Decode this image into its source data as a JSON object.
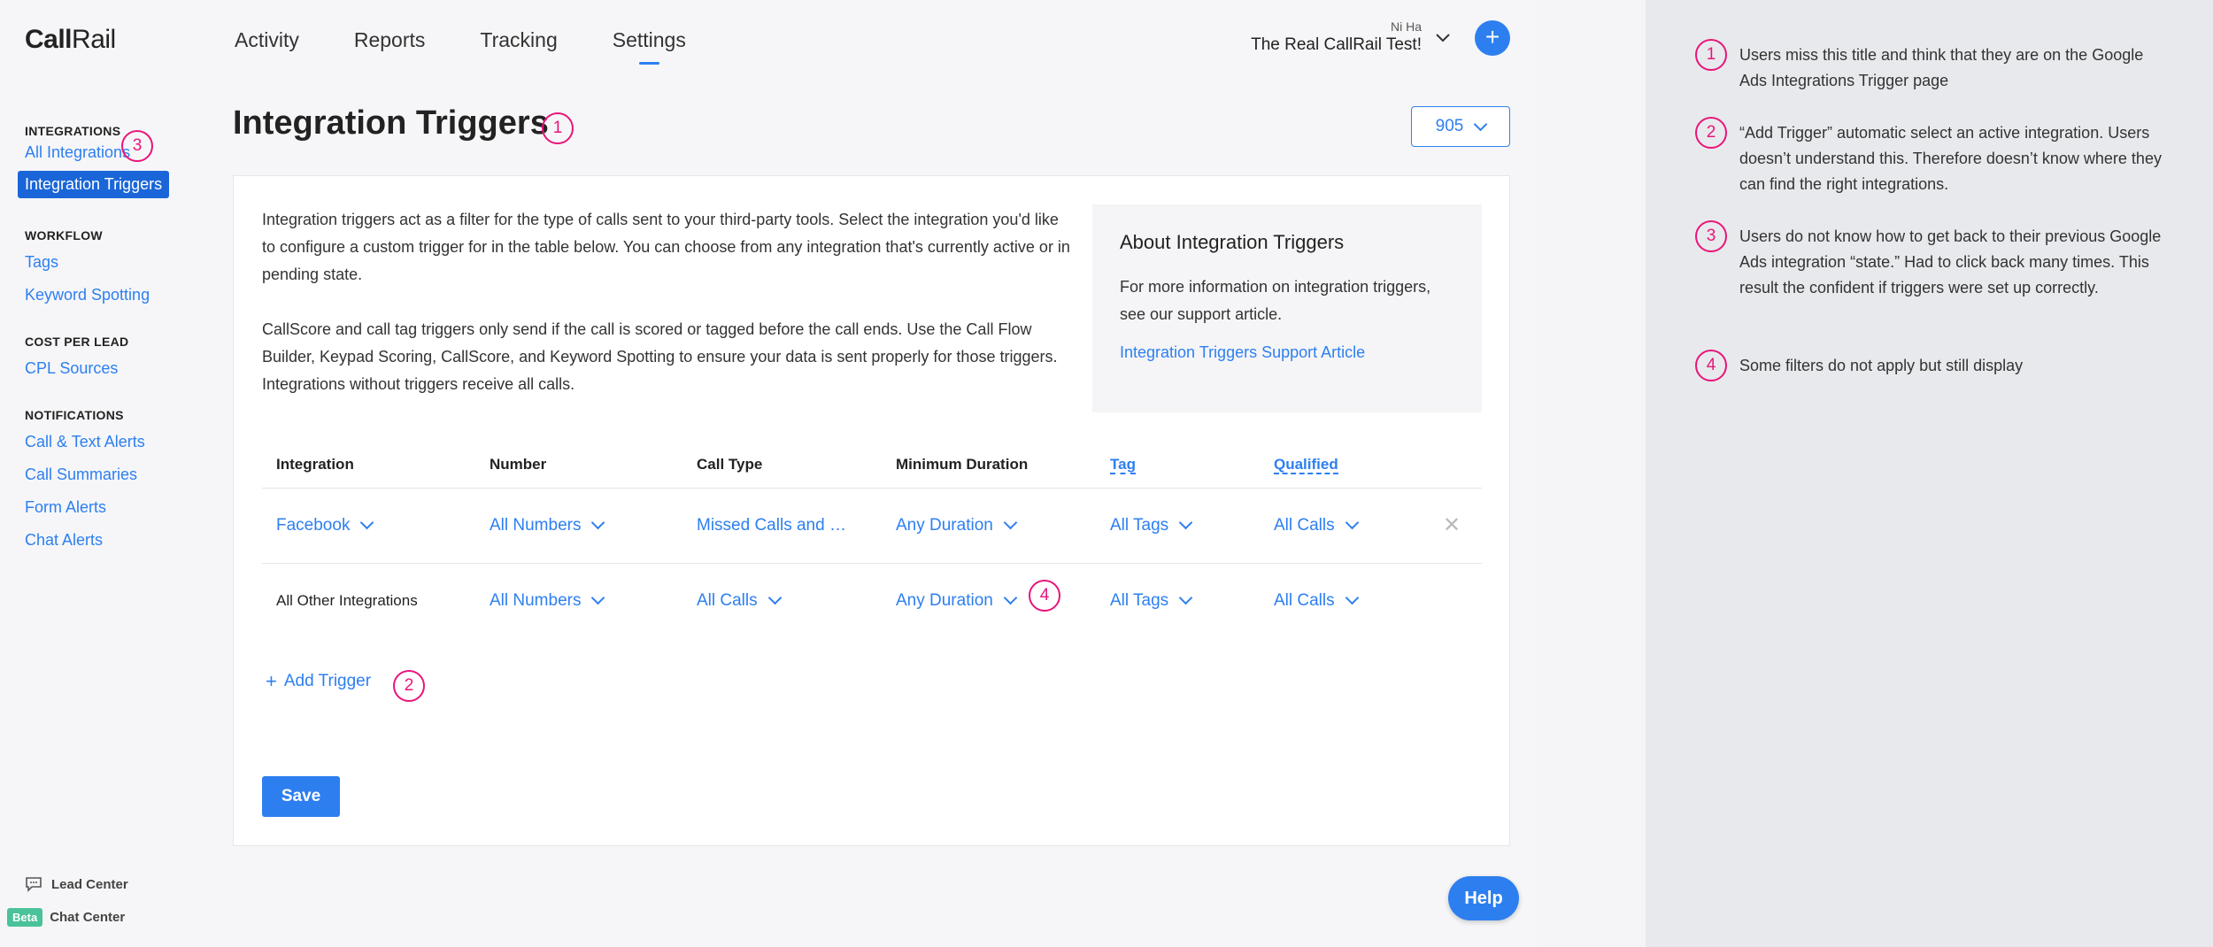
{
  "app": {
    "logo_bold": "Call",
    "logo_light": "Rail",
    "nav": [
      {
        "label": "Activity"
      },
      {
        "label": "Reports"
      },
      {
        "label": "Tracking"
      },
      {
        "label": "Settings",
        "active": true
      }
    ],
    "account": {
      "user": "Ni Ha",
      "company": "The Real CallRail Test!"
    },
    "plus_label": "+"
  },
  "sidebar": {
    "sections": [
      {
        "title": "INTEGRATIONS",
        "items": [
          "All Integrations",
          "Integration Triggers"
        ]
      },
      {
        "title": "WORKFLOW",
        "items": [
          "Tags",
          "Keyword Spotting"
        ]
      },
      {
        "title": "COST PER LEAD",
        "items": [
          "CPL Sources"
        ]
      },
      {
        "title": "NOTIFICATIONS",
        "items": [
          "Call & Text Alerts",
          "Call Summaries",
          "Form Alerts",
          "Chat Alerts"
        ]
      }
    ],
    "bottom": {
      "lead_center": "Lead Center",
      "beta": "Beta",
      "chat_center": "Chat Center"
    }
  },
  "page": {
    "title": "Integration Triggers",
    "company_select": "905",
    "intro_1": "Integration triggers act as a filter for the type of calls sent to your third-party tools. Select the integration you'd like to configure a custom trigger for in the table below. You can choose from any integration that's currently active or in pending state.",
    "intro_2": "CallScore and call tag triggers only send if the call is scored or tagged before the call ends. Use the Call Flow Builder, Keypad Scoring, CallScore, and Keyword Spotting to ensure your data is sent properly for those triggers. Integrations without triggers receive all calls.",
    "about": {
      "title": "About Integration Triggers",
      "body": "For more information on integration triggers, see our support article.",
      "link": "Integration Triggers Support Article"
    },
    "table": {
      "headers": [
        "Integration",
        "Number",
        "Call Type",
        "Minimum Duration",
        "Tag",
        "Qualified"
      ],
      "rows": [
        {
          "integration": "Facebook",
          "number": "All Numbers",
          "call_type": "Missed Calls and …",
          "duration": "Any Duration",
          "tag": "All Tags",
          "qualified": "All Calls"
        },
        {
          "integration": "All Other Integrations",
          "number": "All Numbers",
          "call_type": "All Calls",
          "duration": "Any Duration",
          "tag": "All Tags",
          "qualified": "All Calls"
        }
      ]
    },
    "add_trigger": "Add Trigger",
    "save": "Save",
    "help": "Help"
  },
  "markers": [
    "1",
    "2",
    "3",
    "4"
  ],
  "notes": [
    {
      "num": "1",
      "text": "Users miss this title and think that they are on the Google Ads Integrations Trigger page"
    },
    {
      "num": "2",
      "text": "“Add Trigger” automatic select an active integration. Users doesn’t understand this. Therefore doesn’t know where they can find the right integrations."
    },
    {
      "num": "3",
      "text": "Users do not know how to get back to their previous Google Ads integration “state.”  Had to click back many times. This result the  confident if triggers were set up correctly."
    },
    {
      "num": "4",
      "text": "Some filters do not apply but still display"
    }
  ],
  "colors": {
    "accent": "#2d7ff0",
    "marker": "#e8157a",
    "beta": "#4ac29a"
  }
}
